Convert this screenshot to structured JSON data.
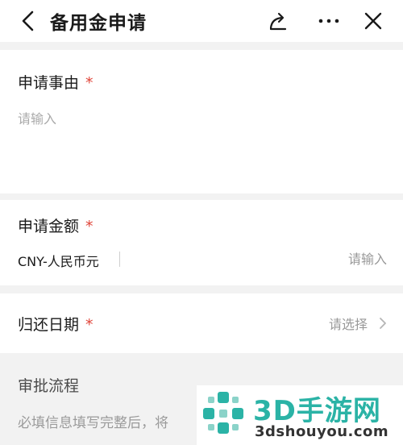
{
  "header": {
    "title": "备用金申请",
    "back_icon": "chevron-left-icon",
    "share_icon": "share-icon",
    "more_icon": "more-dots-icon",
    "close_icon": "close-icon"
  },
  "form": {
    "reason": {
      "label": "申请事由",
      "required_mark": "*",
      "placeholder": "请输入"
    },
    "amount": {
      "label": "申请金额",
      "required_mark": "*",
      "currency": "CNY-人民币元",
      "placeholder": "请输入"
    },
    "return_date": {
      "label": "归还日期",
      "required_mark": "*",
      "placeholder": "请选择"
    }
  },
  "approval_flow": {
    "label": "审批流程",
    "description": "必填信息填写完整后，将"
  },
  "watermark": {
    "brand": "3D手游网",
    "url": "3dshouyou.com"
  },
  "colors": {
    "required": "#e0453a",
    "background": "#f2f2f2",
    "watermark_brand": "#2bb3a6"
  }
}
